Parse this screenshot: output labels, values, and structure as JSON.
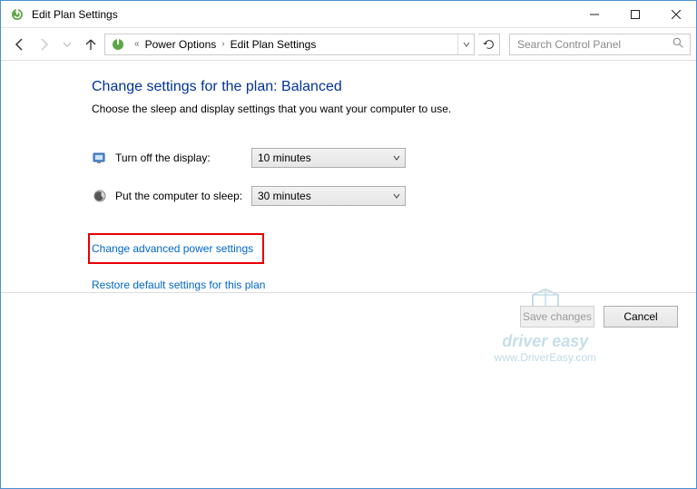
{
  "window": {
    "title": "Edit Plan Settings"
  },
  "breadcrumb": {
    "level1": "Power Options",
    "level2": "Edit Plan Settings"
  },
  "search": {
    "placeholder": "Search Control Panel"
  },
  "page": {
    "heading": "Change settings for the plan: Balanced",
    "subtext": "Choose the sleep and display settings that you want your computer to use."
  },
  "options": {
    "display": {
      "label": "Turn off the display:",
      "value": "10 minutes"
    },
    "sleep": {
      "label": "Put the computer to sleep:",
      "value": "30 minutes"
    }
  },
  "links": {
    "advanced": "Change advanced power settings",
    "restore": "Restore default settings for this plan"
  },
  "buttons": {
    "save": "Save changes",
    "cancel": "Cancel"
  },
  "watermark": {
    "line1": "driver easy",
    "line2": "www.DriverEasy.com"
  }
}
